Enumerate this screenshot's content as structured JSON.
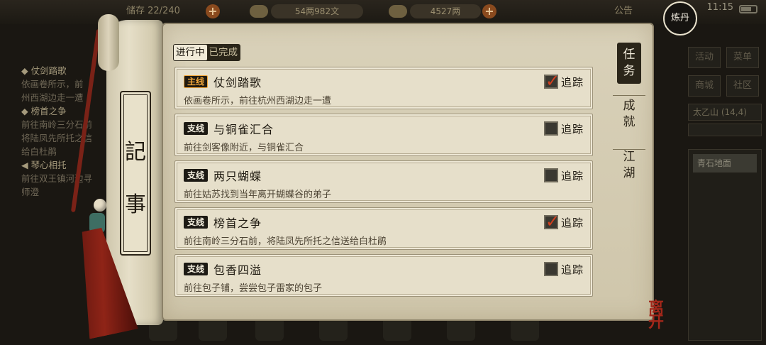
{
  "hud": {
    "capacity": "22/240",
    "money": "54两982文",
    "ingot": "4527两",
    "notice": "公告",
    "time": "11:15",
    "alchemy": "炼丹"
  },
  "left_log": [
    {
      "title": "◆ 仗剑踏歌",
      "lines": [
        "依画卷所示，前",
        "州西湖边走一遭"
      ]
    },
    {
      "title": "◆ 榜首之争",
      "lines": [
        "前往南岭三分石前",
        "将陆凤先所托之信",
        "给白杜鹃"
      ]
    },
    {
      "title": "◀ 琴心相托",
      "lines": [
        "前往双王镇河边寻",
        "师澄"
      ]
    }
  ],
  "right_panel": {
    "buttons": [
      "活动",
      "菜单",
      "商城",
      "社区"
    ],
    "location": "太乙山",
    "coords": "(14,4)",
    "item": "青石地面"
  },
  "scroll": {
    "label_top": "記",
    "label_bottom": "事"
  },
  "tabs": {
    "in_progress": "进行中",
    "completed": "已完成"
  },
  "side_tabs": [
    "任务",
    "成就",
    "江湖"
  ],
  "quests": [
    {
      "type": "主线",
      "title": "仗剑踏歌",
      "desc": "依画卷所示，前往杭州西湖边走一遭",
      "tracked": true
    },
    {
      "type": "支线",
      "title": "与铜雀汇合",
      "desc": "前往剑客像附近，与铜雀汇合",
      "tracked": false
    },
    {
      "type": "支线",
      "title": "两只蝴蝶",
      "desc": "前往姑苏找到当年离开蝴蝶谷的弟子",
      "tracked": false
    },
    {
      "type": "支线",
      "title": "榜首之争",
      "desc": "前往南岭三分石前，将陆凤先所托之信送给白杜鹃",
      "tracked": true
    },
    {
      "type": "支线",
      "title": "包香四溢",
      "desc": "前往包子铺，尝尝包子雷家的包子",
      "tracked": false
    }
  ],
  "track_label": "追踪",
  "leave_label": "离开"
}
